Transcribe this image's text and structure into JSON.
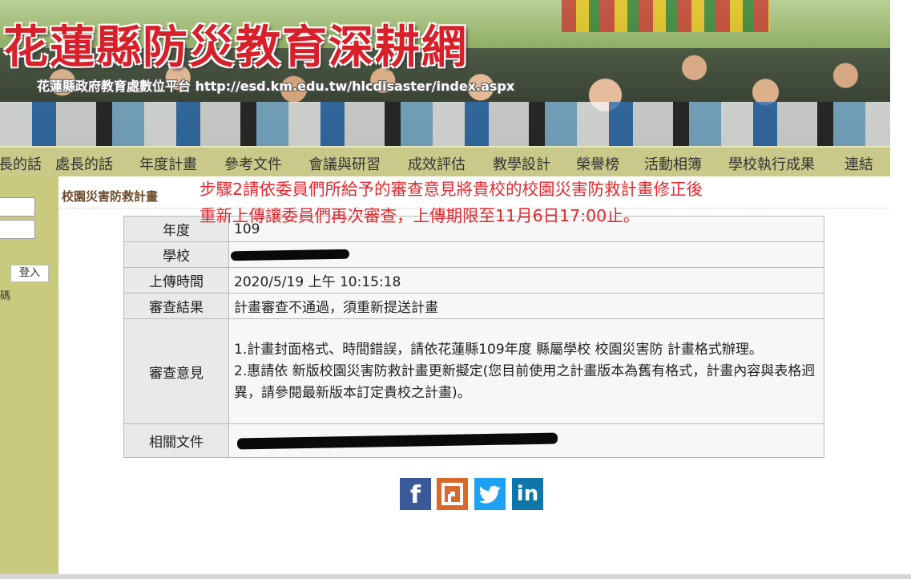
{
  "header": {
    "site_title": "花蓮縣防災教育深耕網",
    "site_subtitle": "花蓮縣政府教育處數位平台 http://esd.km.edu.tw/hlcdisaster/index.aspx"
  },
  "nav": {
    "items": [
      {
        "label": "長的話"
      },
      {
        "label": "處長的話"
      },
      {
        "label": "年度計畫"
      },
      {
        "label": "參考文件"
      },
      {
        "label": "會議與研習"
      },
      {
        "label": "成效評估"
      },
      {
        "label": "教學設計"
      },
      {
        "label": "榮譽榜"
      },
      {
        "label": "活動相簿"
      },
      {
        "label": "學校執行成果"
      },
      {
        "label": "連結"
      }
    ]
  },
  "sidebar": {
    "login_button": "登入",
    "fragment_text": "碼"
  },
  "section": {
    "title": "校園災害防救計畫"
  },
  "annotation": {
    "line1": "步驟2請依委員們所給予的審查意見將貴校的校園災害防救計畫修正後",
    "line2": "重新上傳讓委員們再次審查，上傳期限至11月6日17:00止。"
  },
  "detail": {
    "year_label": "年度",
    "year_value": "109",
    "school_label": "學校",
    "upload_time_label": "上傳時間",
    "upload_time_value": "2020/5/19 上午 10:15:18",
    "result_label": "審查結果",
    "result_value": "計畫審查不通過，須重新提送計畫",
    "comments_label": "審查意見",
    "comment_1": "1.計畫封面格式、時間錯誤，請依花蓮縣109年度 縣屬學校 校園災害防 計畫格式辦理。",
    "comment_2": "2.惠請依 新版校園災害防救計畫更新擬定(您目前使用之計畫版本為舊有格式，計畫內容與表格迥異，請參閱最新版本訂定貴校之計畫)。",
    "docs_label": "相關文件"
  },
  "share": {
    "facebook_icon": "f",
    "plurk_icon": "plurk-icon",
    "twitter_icon": "twitter-bird-icon",
    "linkedin_icon": "in"
  },
  "colors": {
    "nav_bg": "#c9c98a",
    "sidebar_bg": "#c8ca7e",
    "annotation_red": "#e0282e",
    "title_red": "#d8202a"
  }
}
